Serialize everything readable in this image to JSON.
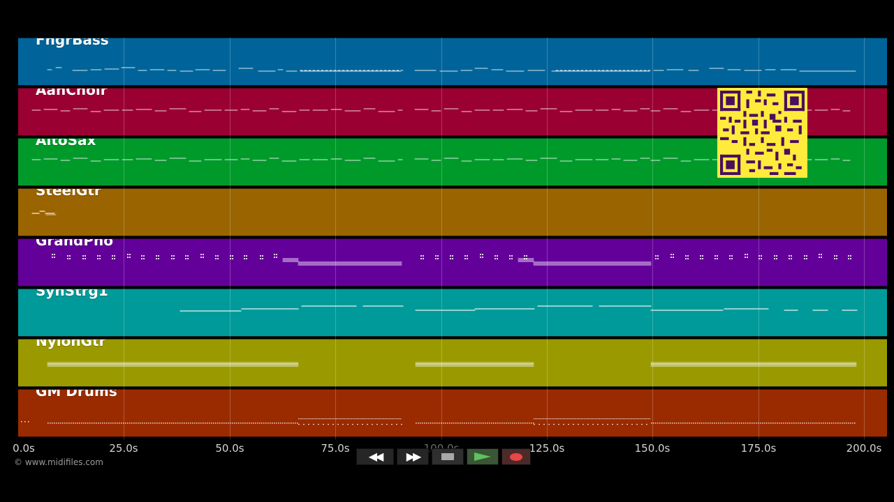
{
  "window": {
    "background": "#000000"
  },
  "tracks": [
    {
      "name": "FngrBass",
      "color": "#00649a",
      "notes": "bass"
    },
    {
      "name": "AahChoir",
      "color": "#9b0033",
      "notes": "choir"
    },
    {
      "name": "AltoSax",
      "color": "#009a2b",
      "notes": "sax"
    },
    {
      "name": "SteelGtr",
      "color": "#9a6400",
      "notes": "steel"
    },
    {
      "name": "GrandPno",
      "color": "#64009a",
      "notes": "piano"
    },
    {
      "name": "SynStrg1",
      "color": "#009a9a",
      "notes": "strings"
    },
    {
      "name": "NylonGtr",
      "color": "#9a9a00",
      "notes": "nylon"
    },
    {
      "name": "GM Drums",
      "color": "#9a2b00",
      "notes": "drums"
    }
  ],
  "timeline": {
    "ticks": [
      {
        "seconds": 0,
        "label": "0.0s"
      },
      {
        "seconds": 25,
        "label": "25.0s"
      },
      {
        "seconds": 50,
        "label": "50.0s"
      },
      {
        "seconds": 75,
        "label": "75.0s"
      },
      {
        "seconds": 100,
        "label": "100.0s"
      },
      {
        "seconds": 125,
        "label": "125.0s"
      },
      {
        "seconds": 150,
        "label": "150.0s"
      },
      {
        "seconds": 175,
        "label": "175.0s"
      },
      {
        "seconds": 200,
        "label": "200.0s"
      }
    ]
  },
  "copyright": "© www.midifiles.com",
  "controls": {
    "rewind": "◀◀",
    "forward": "▶▶",
    "stop": "stop",
    "play": "play",
    "record": "record",
    "colors": {
      "play": "#60c160",
      "record": "#e74747",
      "stop": "#a8a8a8"
    }
  },
  "qr": {
    "background": "#ffeb3b",
    "foreground": "#4a0f5f"
  }
}
